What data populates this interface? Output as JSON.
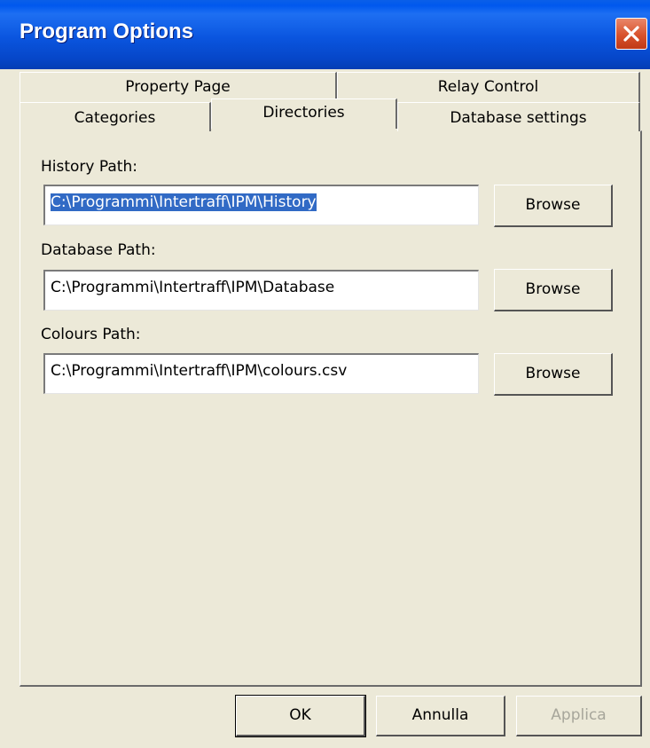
{
  "window": {
    "title": "Program Options",
    "close_icon": "close-x-icon"
  },
  "tabs": {
    "row_back": [
      {
        "label": "Property Page"
      },
      {
        "label": "Relay Control"
      }
    ],
    "row_front": [
      {
        "label": "Categories"
      },
      {
        "label": "Directories"
      },
      {
        "label": "Database settings"
      }
    ],
    "selected": "Directories"
  },
  "directories": {
    "history": {
      "label": "History Path:",
      "value": "C:\\Programmi\\Intertraff\\IPM\\History",
      "browse_label": "Browse"
    },
    "database": {
      "label": "Database Path:",
      "value": "C:\\Programmi\\Intertraff\\IPM\\Database",
      "browse_label": "Browse"
    },
    "colours": {
      "label": "Colours Path:",
      "value": "C:\\Programmi\\Intertraff\\IPM\\colours.csv",
      "browse_label": "Browse"
    }
  },
  "footer": {
    "ok_label": "OK",
    "cancel_label": "Annulla",
    "apply_label": "Applica"
  },
  "colors": {
    "title_bar": "#0058EE",
    "dialog_face": "#ECE9D8",
    "selection": "#316AC5",
    "close_button": "#D8522C"
  }
}
